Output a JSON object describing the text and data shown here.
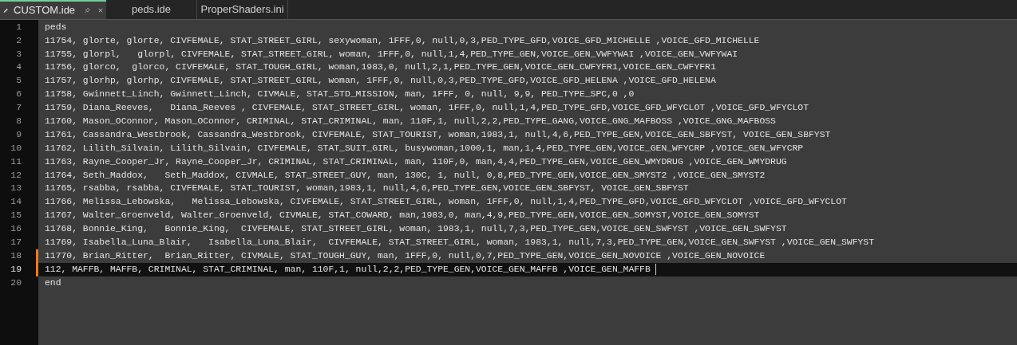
{
  "tabs": [
    {
      "label": "CUSTOM.ide",
      "selected": true,
      "modified": true
    },
    {
      "label": "peds.ide",
      "selected": false,
      "modified": false
    },
    {
      "label": "ProperShaders.ini",
      "selected": false,
      "modified": false
    }
  ],
  "lines": [
    {
      "number": "1",
      "text": "peds",
      "changed": false,
      "current": false
    },
    {
      "number": "2",
      "text": "11754, glorte, glorte, CIVFEMALE, STAT_STREET_GIRL, sexywoman, 1FFF,0, null,0,3,PED_TYPE_GFD,VOICE_GFD_MICHELLE ,VOICE_GFD_MICHELLE",
      "changed": false,
      "current": false
    },
    {
      "number": "3",
      "text": "11755, glorpl,   glorpl, CIVFEMALE, STAT_STREET_GIRL, woman, 1FFF,0, null,1,4,PED_TYPE_GEN,VOICE_GEN_VWFYWAI ,VOICE_GEN_VWFYWAI",
      "changed": false,
      "current": false
    },
    {
      "number": "4",
      "text": "11756, glorco,  glorco, CIVFEMALE, STAT_TOUGH_GIRL, woman,1983,0, null,2,1,PED_TYPE_GEN,VOICE_GEN_CWFYFR1,VOICE_GEN_CWFYFR1",
      "changed": false,
      "current": false
    },
    {
      "number": "5",
      "text": "11757, glorhp, glorhp, CIVFEMALE, STAT_STREET_GIRL, woman, 1FFF,0, null,0,3,PED_TYPE_GFD,VOICE_GFD_HELENA ,VOICE_GFD_HELENA",
      "changed": false,
      "current": false
    },
    {
      "number": "6",
      "text": "11758, Gwinnett_Linch, Gwinnett_Linch, CIVMALE, STAT_STD_MISSION, man, 1FFF, 0, null, 9,9, PED_TYPE_SPC,0 ,0",
      "changed": false,
      "current": false
    },
    {
      "number": "7",
      "text": "11759, Diana_Reeves,   Diana_Reeves , CIVFEMALE, STAT_STREET_GIRL, woman, 1FFF,0, null,1,4,PED_TYPE_GFD,VOICE_GFD_WFYCLOT ,VOICE_GFD_WFYCLOT",
      "changed": false,
      "current": false
    },
    {
      "number": "8",
      "text": "11760, Mason_OConnor, Mason_OConnor, CRIMINAL, STAT_CRIMINAL, man, 110F,1, null,2,2,PED_TYPE_GANG,VOICE_GNG_MAFBOSS ,VOICE_GNG_MAFBOSS",
      "changed": false,
      "current": false
    },
    {
      "number": "9",
      "text": "11761, Cassandra_Westbrook, Cassandra_Westbrook, CIVFEMALE, STAT_TOURIST, woman,1983,1, null,4,6,PED_TYPE_GEN,VOICE_GEN_SBFYST, VOICE_GEN_SBFYST",
      "changed": false,
      "current": false
    },
    {
      "number": "10",
      "text": "11762, Lilith_Silvain, Lilith_Silvain, CIVFEMALE, STAT_SUIT_GIRL, busywoman,1000,1, man,1,4,PED_TYPE_GEN,VOICE_GEN_WFYCRP ,VOICE_GEN_WFYCRP",
      "changed": false,
      "current": false
    },
    {
      "number": "11",
      "text": "11763, Rayne_Cooper_Jr, Rayne_Cooper_Jr, CRIMINAL, STAT_CRIMINAL, man, 110F,0, man,4,4,PED_TYPE_GEN,VOICE_GEN_WMYDRUG ,VOICE_GEN_WMYDRUG",
      "changed": false,
      "current": false
    },
    {
      "number": "12",
      "text": "11764, Seth_Maddox,   Seth_Maddox, CIVMALE, STAT_STREET_GUY, man, 130C, 1, null, 0,8,PED_TYPE_GEN,VOICE_GEN_SMYST2 ,VOICE_GEN_SMYST2",
      "changed": false,
      "current": false
    },
    {
      "number": "13",
      "text": "11765, rsabba, rsabba, CIVFEMALE, STAT_TOURIST, woman,1983,1, null,4,6,PED_TYPE_GEN,VOICE_GEN_SBFYST, VOICE_GEN_SBFYST",
      "changed": false,
      "current": false
    },
    {
      "number": "14",
      "text": "11766, Melissa_Lebowska,   Melissa_Lebowska, CIVFEMALE, STAT_STREET_GIRL, woman, 1FFF,0, null,1,4,PED_TYPE_GFD,VOICE_GFD_WFYCLOT ,VOICE_GFD_WFYCLOT",
      "changed": false,
      "current": false
    },
    {
      "number": "15",
      "text": "11767, Walter_Groenveld, Walter_Groenveld, CIVMALE, STAT_COWARD, man,1983,0, man,4,9,PED_TYPE_GEN,VOICE_GEN_SOMYST,VOICE_GEN_SOMYST",
      "changed": false,
      "current": false
    },
    {
      "number": "16",
      "text": "11768, Bonnie_King,   Bonnie_King,  CIVFEMALE, STAT_STREET_GIRL, woman, 1983,1, null,7,3,PED_TYPE_GEN,VOICE_GEN_SWFYST ,VOICE_GEN_SWFYST",
      "changed": false,
      "current": false
    },
    {
      "number": "17",
      "text": "11769, Isabella_Luna_Blair,   Isabella_Luna_Blair,  CIVFEMALE, STAT_STREET_GIRL, woman, 1983,1, null,7,3,PED_TYPE_GEN,VOICE_GEN_SWFYST ,VOICE_GEN_SWFYST",
      "changed": false,
      "current": false
    },
    {
      "number": "18",
      "text": "11770, Brian_Ritter,  Brian_Ritter, CIVMALE, STAT_TOUGH_GUY, man, 1FFF,0, null,0,7,PED_TYPE_GEN,VOICE_GEN_NOVOICE ,VOICE_GEN_NOVOICE",
      "changed": true,
      "current": false
    },
    {
      "number": "19",
      "text": "112, MAFFB, MAFFB, CRIMINAL, STAT_CRIMINAL, man, 110F,1, null,2,2,PED_TYPE_GEN,VOICE_GEN_MAFFB ,VOICE_GEN_MAFFB",
      "changed": true,
      "current": true
    },
    {
      "number": "20",
      "text": "end",
      "changed": false,
      "current": false
    }
  ]
}
